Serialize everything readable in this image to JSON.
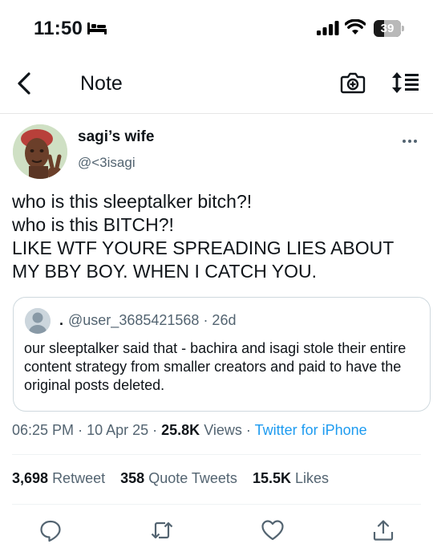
{
  "status_bar": {
    "time": "11:50",
    "battery_level": "39",
    "battery_fraction": 0.39
  },
  "header": {
    "title": "Note",
    "icons": [
      "back-chevron-icon",
      "camera-icon",
      "sort-icon"
    ]
  },
  "tweet": {
    "display_name": "sagi’s wife",
    "handle": "@<3isagi",
    "text": "who is this sleeptalker bitch?!\nwho is this BITCH?!\nLIKE WTF YOURE SPREADING LIES ABOUT MY BBY BOY. WHEN I CATCH YOU.",
    "quote": {
      "name": ".",
      "handle": "@user_3685421568",
      "time": "· 26d",
      "text": "our sleeptalker said that - bachira and isagi stole their entire content strategy from smaller creators and paid to have the original posts deleted."
    },
    "meta": {
      "time": "06:25 PM",
      "date": "10 Apr 25",
      "views_count": "25.8K",
      "views_label": "Views",
      "source": "Twitter for iPhone"
    },
    "stats": {
      "retweets": "3,698",
      "retweets_label": "Retweet",
      "quotes": "358",
      "quotes_label": "Quote Tweets",
      "likes": "15.5K",
      "likes_label": "Likes"
    }
  },
  "actions": [
    "reply-icon",
    "retweet-icon",
    "like-icon",
    "share-icon"
  ]
}
